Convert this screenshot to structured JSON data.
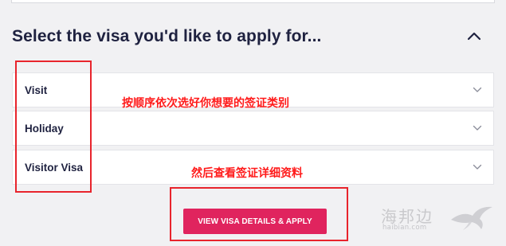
{
  "section": {
    "title": "Select the visa you'd like to apply for...",
    "collapse_icon": "chevron-up-icon"
  },
  "visas": [
    {
      "label": "Visit",
      "icon": "chevron-down-icon"
    },
    {
      "label": "Holiday",
      "icon": "chevron-down-icon"
    },
    {
      "label": "Visitor Visa",
      "icon": "chevron-down-icon"
    }
  ],
  "annotations": {
    "step1": "按顺序依次选好你想要的签证类别",
    "step2": "然后查看签证详细资料"
  },
  "apply_button": {
    "label": "VIEW VISA DETAILS & APPLY"
  },
  "watermark": {
    "cn": "海邦边",
    "en": "haibian.com"
  },
  "colors": {
    "accent": "#e0245e",
    "heading": "#1f2240",
    "background": "#f1f1f3",
    "annotation": "#e8242c"
  }
}
